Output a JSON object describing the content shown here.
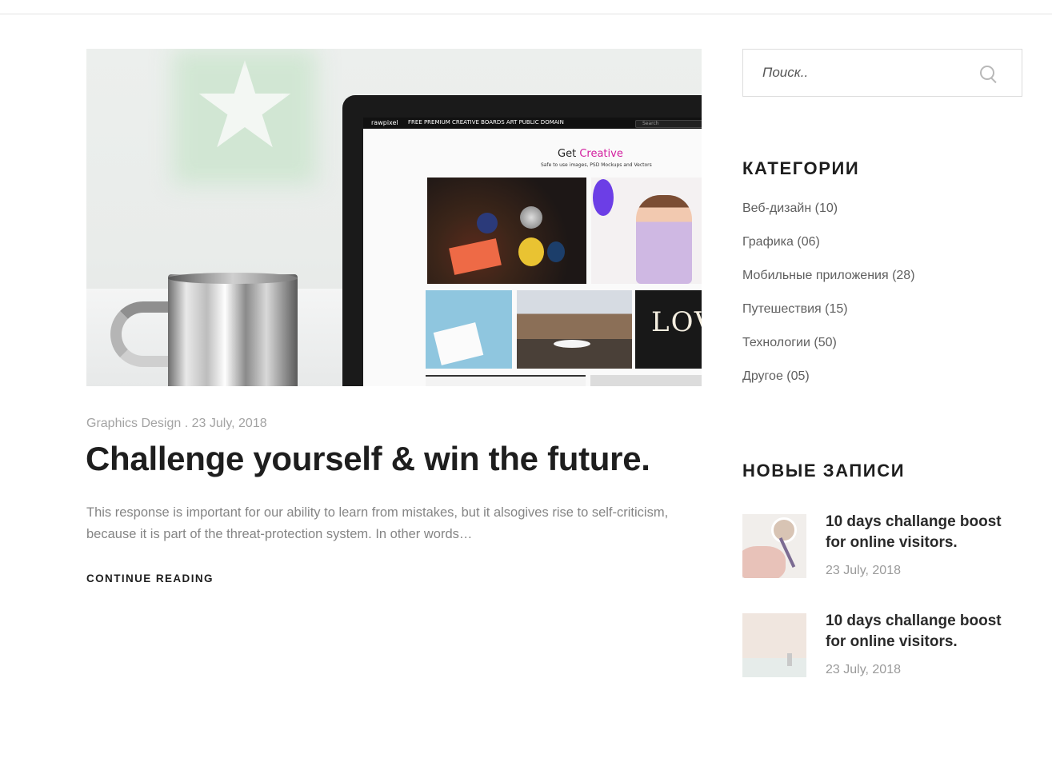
{
  "hero": {
    "screen": {
      "brand": "rawpixel",
      "nav": "FREE   PREMIUM   CREATIVE BOARDS   ART   PUBLIC DOMAIN",
      "search": "Search",
      "heading_prefix": "Get",
      "heading_accent": "Creative",
      "subheading": "Safe to use images, PSD Mockups and Vectors",
      "love_text": "LOV"
    }
  },
  "post": {
    "category": "Graphics Design",
    "separator": " . ",
    "date": "23 July, 2018",
    "title": "Challenge yourself & win the future.",
    "excerpt": "This response is important for our ability to learn from mistakes, but it alsogives rise to self-criticism, because it is part of the threat-protection system. In other words…",
    "continue_label": "CONTINUE READING"
  },
  "sidebar": {
    "search": {
      "placeholder": "Поиск.."
    },
    "categories": {
      "title": "КАТЕГОРИИ",
      "items": [
        {
          "label": "Веб-дизайн (10)"
        },
        {
          "label": "Графика (06)"
        },
        {
          "label": "Мобильные приложения (28)"
        },
        {
          "label": "Путешествия (15)"
        },
        {
          "label": "Технологии (50)"
        },
        {
          "label": "Другое (05)"
        }
      ]
    },
    "recent": {
      "title": "НОВЫЕ ЗАПИСИ",
      "items": [
        {
          "title": "10 days challange boost for online visitors.",
          "date": "23 July, 2018"
        },
        {
          "title": "10 days challange boost for online visitors.",
          "date": "23 July, 2018"
        }
      ]
    }
  },
  "colors": {
    "text_dark": "#1e1e1e",
    "text_muted": "#858585",
    "border": "#dcdcdc",
    "accent_magenta": "#d21c9e"
  }
}
